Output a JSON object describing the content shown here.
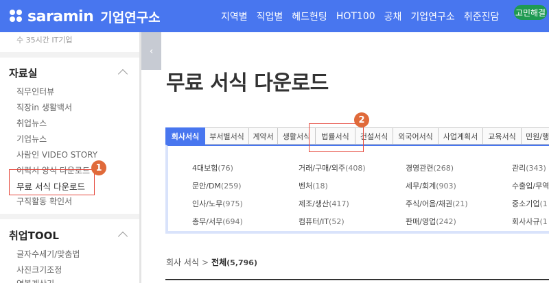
{
  "header": {
    "logo_text": "saramin",
    "logo_sub": "기업연구소",
    "nav": [
      "지역별",
      "직업별",
      "헤드헌팅",
      "HOT100",
      "공채",
      "기업연구소",
      "취준진담"
    ],
    "badge": "고민해결"
  },
  "sidebar": {
    "prev_item": "수 35시간 IT기업",
    "section1_title": "자료실",
    "section1_items": [
      "직무인터뷰",
      "직장in 생활백서",
      "취업뉴스",
      "기업뉴스",
      "사람인 VIDEO STORY",
      "이력서 양식 다운로드",
      "무료 서식 다운로드",
      "구직활동 확인서"
    ],
    "section2_title": "취업TOOL",
    "section2_items": [
      "글자수세기/맞춤법",
      "사진크기조정",
      "연봉계산기"
    ]
  },
  "collapse_icon": "‹",
  "main": {
    "title": "무료 서식 다운로드",
    "tabs": [
      "회사서식",
      "부서별서식",
      "계약서",
      "생활서식",
      "법률서식",
      "건설서식",
      "외국어서식",
      "사업계획서",
      "교육서식",
      "민원/행정"
    ],
    "categories": [
      {
        "name": "4대보험",
        "count": "(76)"
      },
      {
        "name": "거래/구매/외주",
        "count": "(408)"
      },
      {
        "name": "경영관련",
        "count": "(268)"
      },
      {
        "name": "관리",
        "count": "(343)"
      },
      {
        "name": "문안/DM",
        "count": "(259)"
      },
      {
        "name": "벤처",
        "count": "(18)"
      },
      {
        "name": "세무/회계",
        "count": "(903)"
      },
      {
        "name": "수출입/무역",
        "count": ""
      },
      {
        "name": "인사/노무",
        "count": "(975)"
      },
      {
        "name": "제조/생산",
        "count": "(417)"
      },
      {
        "name": "주식/어음/채권",
        "count": "(21)"
      },
      {
        "name": "중소기업",
        "count": "(1"
      },
      {
        "name": "총무/서무",
        "count": "(694)"
      },
      {
        "name": "컴퓨터/IT",
        "count": "(52)"
      },
      {
        "name": "판매/영업",
        "count": "(242)"
      },
      {
        "name": "회사사규",
        "count": "(1"
      }
    ],
    "breadcrumb": {
      "root": "회사 서식",
      "sep": ">",
      "current": "전체",
      "count": "(5,796)"
    }
  },
  "annotations": [
    "1",
    "2"
  ],
  "colors": {
    "brand": "#4876ef",
    "annotation": "#e5473b",
    "badge": "#1f9a52"
  }
}
